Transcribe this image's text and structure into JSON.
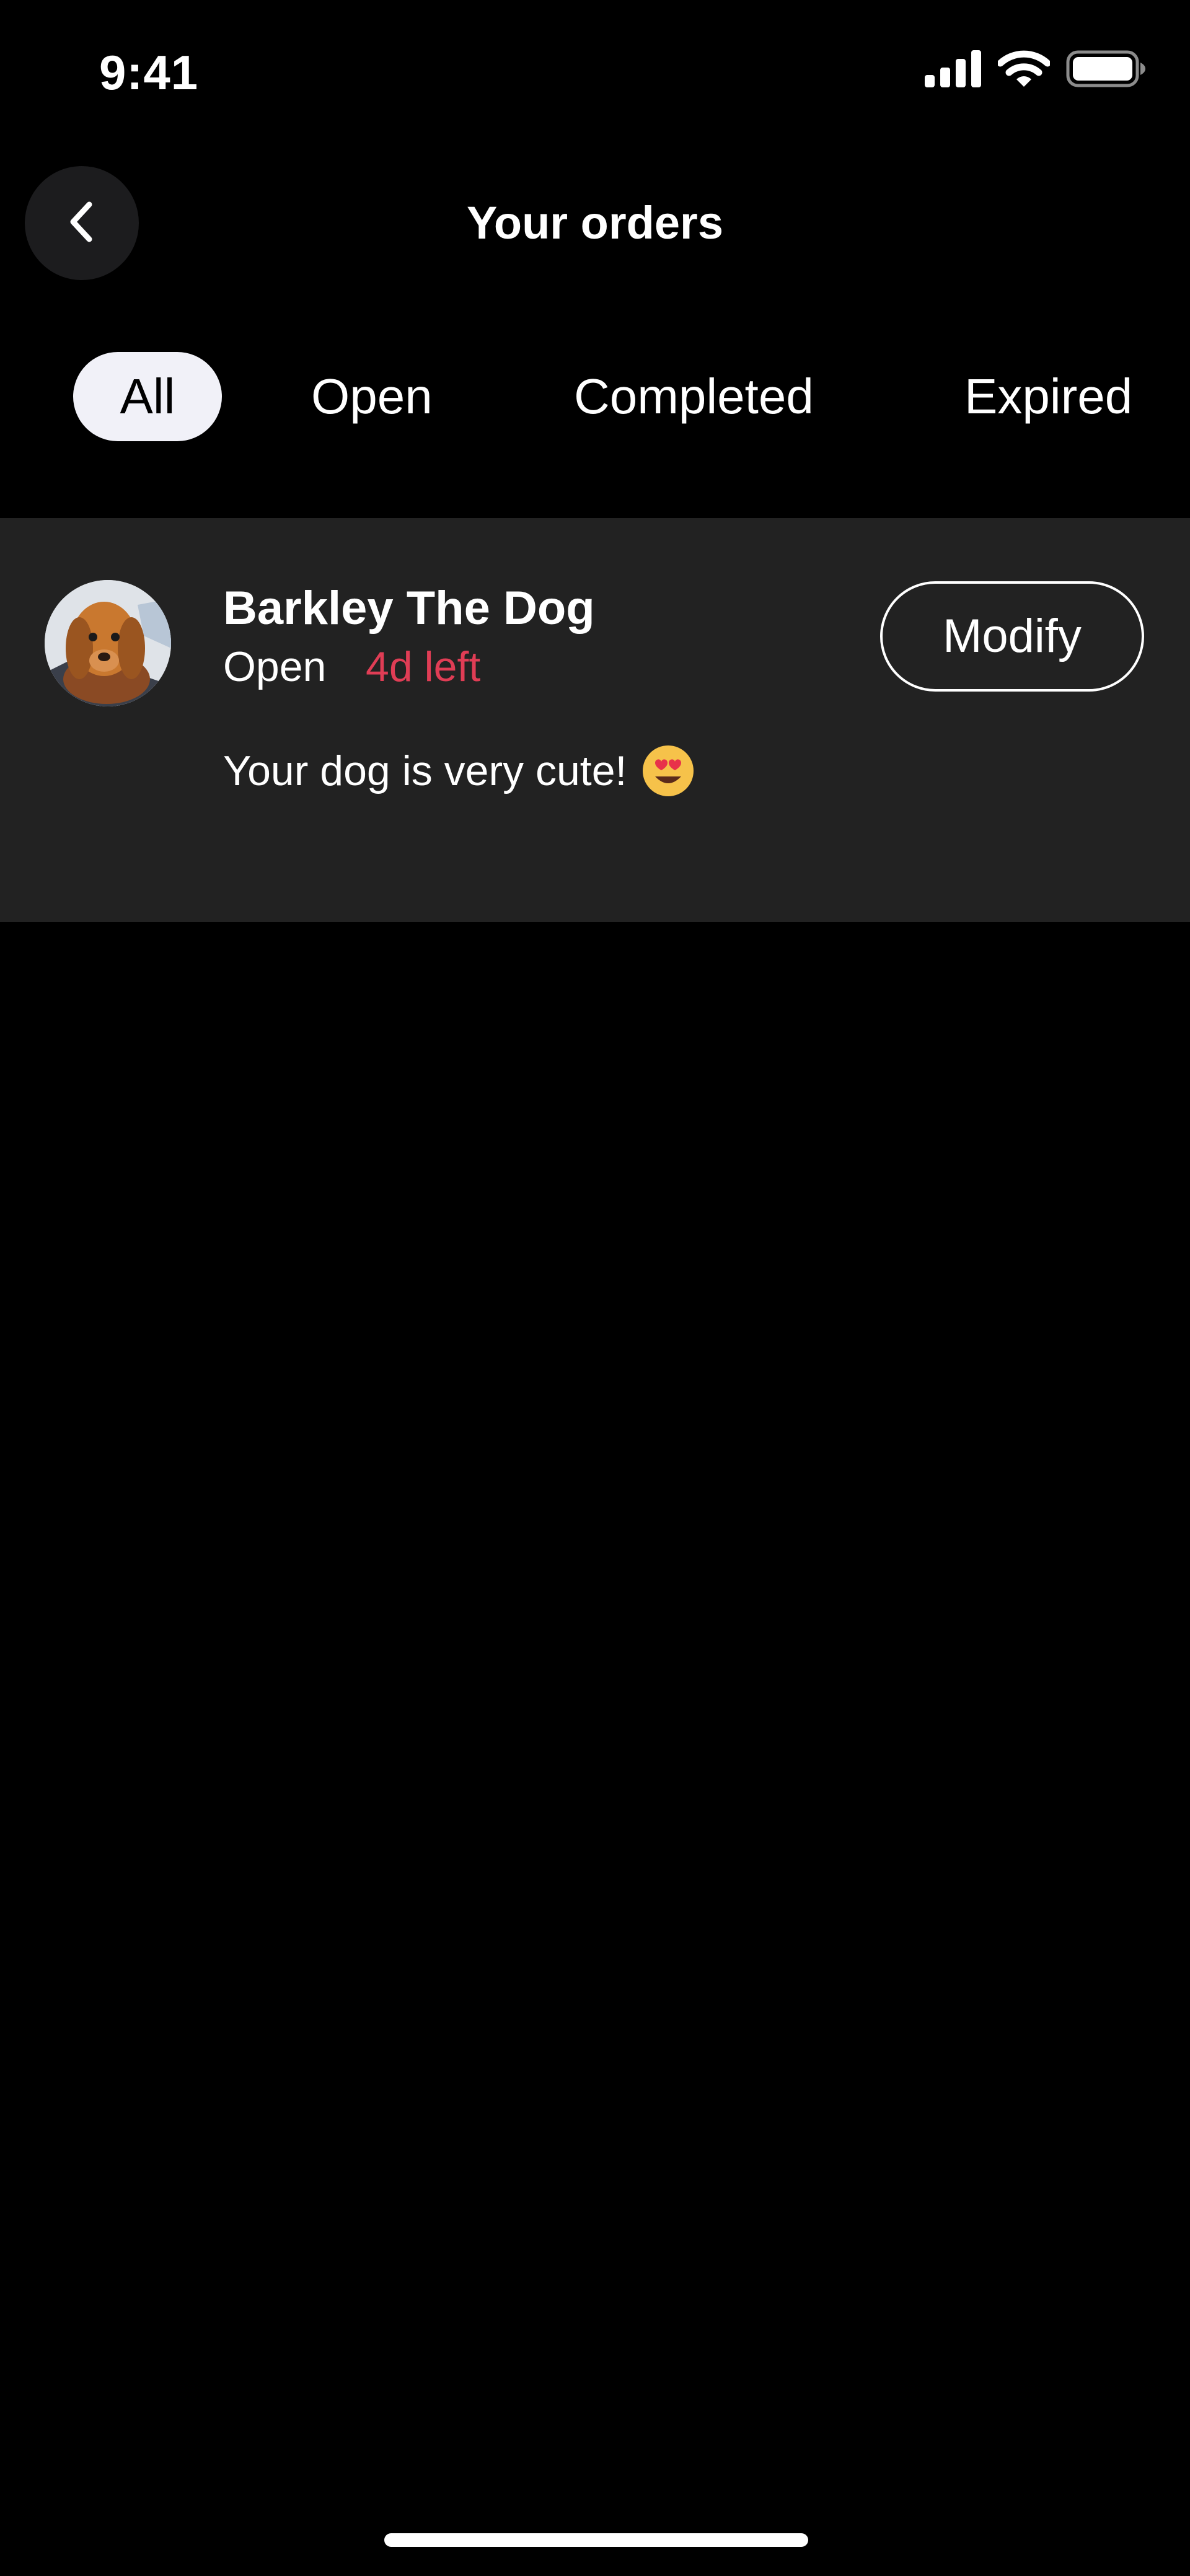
{
  "status_bar": {
    "time": "9:41",
    "icons": [
      "signal-icon",
      "wifi-icon",
      "battery-icon"
    ]
  },
  "header": {
    "title": "Your orders",
    "back_icon": "chevron-left-icon"
  },
  "filters": {
    "tabs": [
      {
        "label": "All",
        "active": true
      },
      {
        "label": "Open",
        "active": false
      },
      {
        "label": "Completed",
        "active": false
      },
      {
        "label": "Expired",
        "active": false
      }
    ]
  },
  "orders": [
    {
      "name": "Barkley The Dog",
      "status": "Open",
      "time_left": "4d left",
      "message": "Your dog is very cute!",
      "message_emoji": "heart-eyes-emoji",
      "action_label": "Modify"
    }
  ],
  "colors": {
    "background": "#000000",
    "card": "#222222",
    "accent_red": "#e03d55",
    "active_tab": "#f1f1f8"
  }
}
